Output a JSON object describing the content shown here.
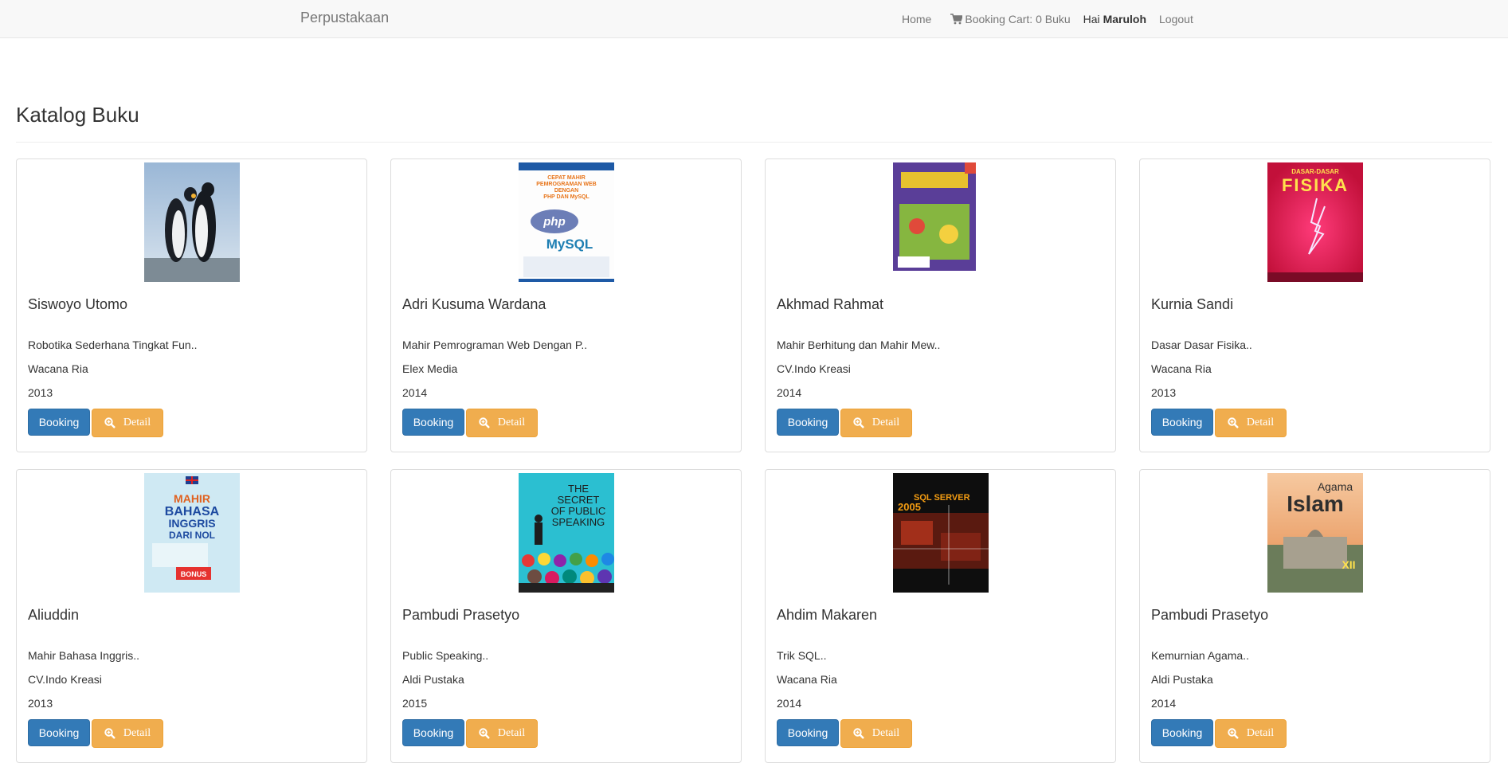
{
  "navbar": {
    "brand": "Perpustakaan",
    "home": "Home",
    "cart_label": "Booking Cart: 0 Buku",
    "greeting_prefix": "Hai ",
    "user_name": "Maruloh",
    "logout": "Logout"
  },
  "page": {
    "title": "Katalog Buku"
  },
  "buttons": {
    "booking": "Booking",
    "detail": "Detail"
  },
  "books": [
    {
      "author": "Siswoyo Utomo",
      "title": "Robotika Sederhana Tingkat Fun..",
      "publisher": "Wacana Ria",
      "year": "2013",
      "cover": "penguins-photo"
    },
    {
      "author": "Adri Kusuma Wardana",
      "title": "Mahir Pemrograman Web Dengan P..",
      "publisher": "Elex Media",
      "year": "2014",
      "cover": "php-mysql-book"
    },
    {
      "author": "Akhmad Rahmat",
      "title": "Mahir Berhitung dan Mahir Mew..",
      "publisher": "CV.Indo Kreasi",
      "year": "2014",
      "cover": "berhitung-book"
    },
    {
      "author": "Kurnia Sandi",
      "title": "Dasar Dasar Fisika..",
      "publisher": "Wacana Ria",
      "year": "2013",
      "cover": "fisika-book"
    },
    {
      "author": "Aliuddin",
      "title": "Mahir Bahasa Inggris..",
      "publisher": "CV.Indo Kreasi",
      "year": "2013",
      "cover": "bahasa-inggris-book"
    },
    {
      "author": "Pambudi Prasetyo",
      "title": "Public Speaking..",
      "publisher": "Aldi Pustaka",
      "year": "2015",
      "cover": "public-speaking-book"
    },
    {
      "author": "Ahdim Makaren",
      "title": "Trik SQL..",
      "publisher": "Wacana Ria",
      "year": "2014",
      "cover": "sql-server-book"
    },
    {
      "author": "Pambudi Prasetyo",
      "title": "Kemurnian Agama..",
      "publisher": "Aldi Pustaka",
      "year": "2014",
      "cover": "agama-islam-book"
    }
  ],
  "covers": {
    "php_text_1": "CEPAT MAHIR",
    "php_text_2": "PEMROGRAMAN WEB",
    "php_text_3": "DENGAN",
    "php_text_4": "PHP DAN MySQL",
    "php_logo": "php",
    "mysql_logo": "MySQL",
    "fisika_top": "DASAR-DASAR",
    "fisika_title": "FISIKA",
    "inggris_1": "MAHIR",
    "inggris_2": "BAHASA",
    "inggris_3": "INGGRIS",
    "inggris_4": "DARI NOL",
    "inggris_bonus": "BONUS",
    "speaking_1": "THE",
    "speaking_2": "SECRET",
    "speaking_3": "OF PUBLIC",
    "speaking_4": "SPEAKING",
    "sql_1": "SQL SERVER",
    "sql_2": "2005",
    "islam_1": "Agama",
    "islam_2": "Islam",
    "islam_3": "XII"
  },
  "colors": {
    "primary": "#337ab7",
    "warning": "#f0ad4e",
    "navbar_bg": "#f8f8f8"
  }
}
